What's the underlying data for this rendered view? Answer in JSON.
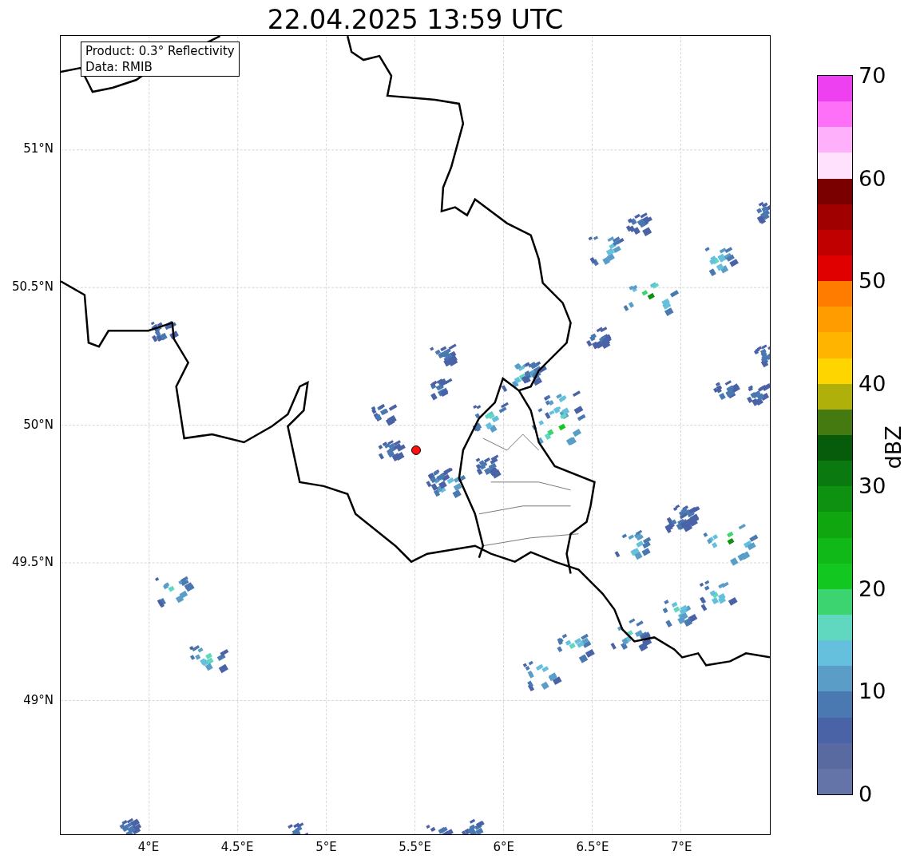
{
  "title": "22.04.2025 13:59 UTC",
  "legend": [
    "Product: 0.3° Reflectivity",
    "Data: RMIB"
  ],
  "lat_labels": [
    "51°N",
    "50.5°N",
    "50°N",
    "49.5°N",
    "49°N"
  ],
  "lon_labels": [
    "4°E",
    "4.5°E",
    "5°E",
    "5.5°E",
    "6°E",
    "6.5°E",
    "7°E"
  ],
  "colorbar": {
    "label": "dBZ",
    "ticks": [
      "70",
      "60",
      "50",
      "40",
      "30",
      "20",
      "10",
      "0"
    ],
    "bins": [
      {
        "color": "#6474a8"
      },
      {
        "color": "#586aa0"
      },
      {
        "color": "#4a62a6"
      },
      {
        "color": "#4a78b0"
      },
      {
        "color": "#5a9ec8"
      },
      {
        "color": "#64c0dc"
      },
      {
        "color": "#60d8c0"
      },
      {
        "color": "#3cd470"
      },
      {
        "color": "#12c820"
      },
      {
        "color": "#10b818"
      },
      {
        "color": "#10a610"
      },
      {
        "color": "#0e9010"
      },
      {
        "color": "#0a7a10"
      },
      {
        "color": "#065c0a"
      },
      {
        "color": "#447a10"
      },
      {
        "color": "#b0b00a"
      },
      {
        "color": "#ffd500"
      },
      {
        "color": "#ffb400"
      },
      {
        "color": "#ff9c00"
      },
      {
        "color": "#ff7c00"
      },
      {
        "color": "#e00000"
      },
      {
        "color": "#c00000"
      },
      {
        "color": "#a00000"
      },
      {
        "color": "#7a0000"
      },
      {
        "color": "#ffe0fd"
      },
      {
        "color": "#ffb0fb"
      },
      {
        "color": "#ff70f8"
      },
      {
        "color": "#ee40f0"
      }
    ]
  }
}
